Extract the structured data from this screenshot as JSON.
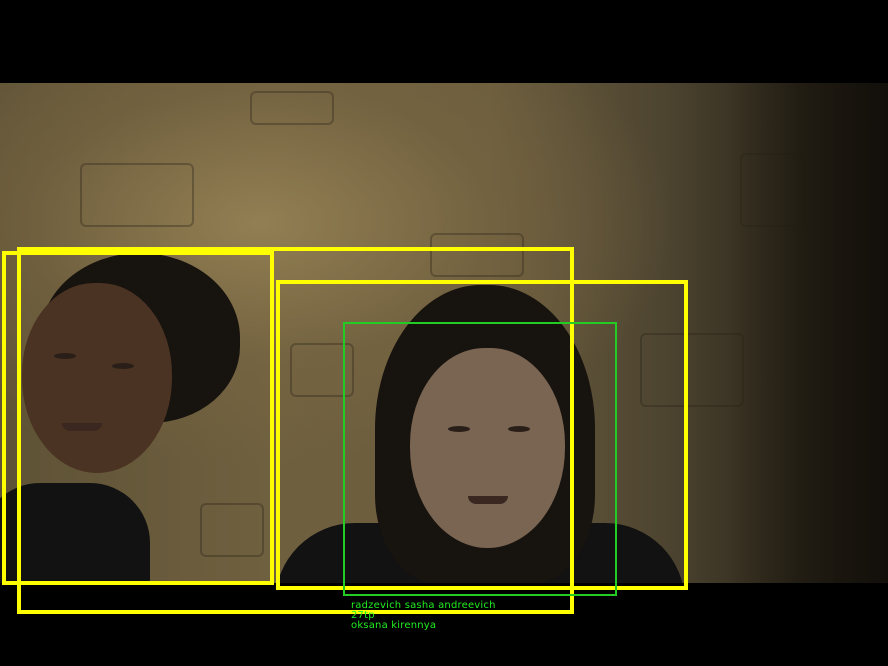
{
  "image": {
    "content": "webcam frame with face detection boxes",
    "colors": {
      "detection_box": "#ffff00",
      "match_box": "#22cc22",
      "label_text": "#22ee22",
      "letterbox": "#000000"
    }
  },
  "labels": {
    "line1": "radzevich sasha andreevich",
    "line2": "27tp",
    "line3": "oksana kirennya"
  }
}
